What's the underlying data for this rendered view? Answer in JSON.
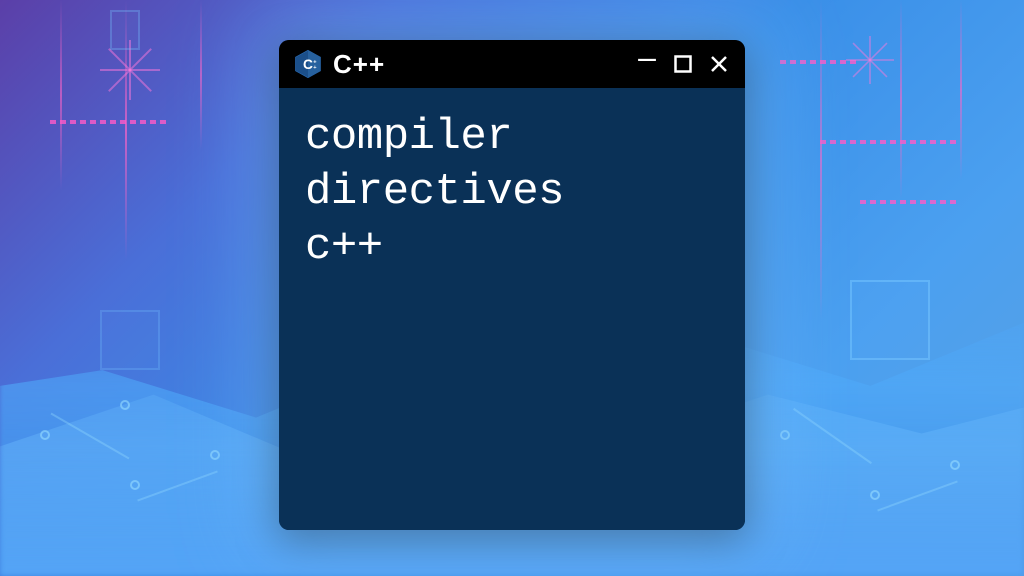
{
  "window": {
    "title": "C++",
    "icon_name": "cpp-logo-icon"
  },
  "content": {
    "lines": [
      "compiler",
      "directives",
      "c++"
    ]
  },
  "colors": {
    "window_bg": "#0a3157",
    "titlebar_bg": "#000000",
    "text": "#ffffff"
  }
}
